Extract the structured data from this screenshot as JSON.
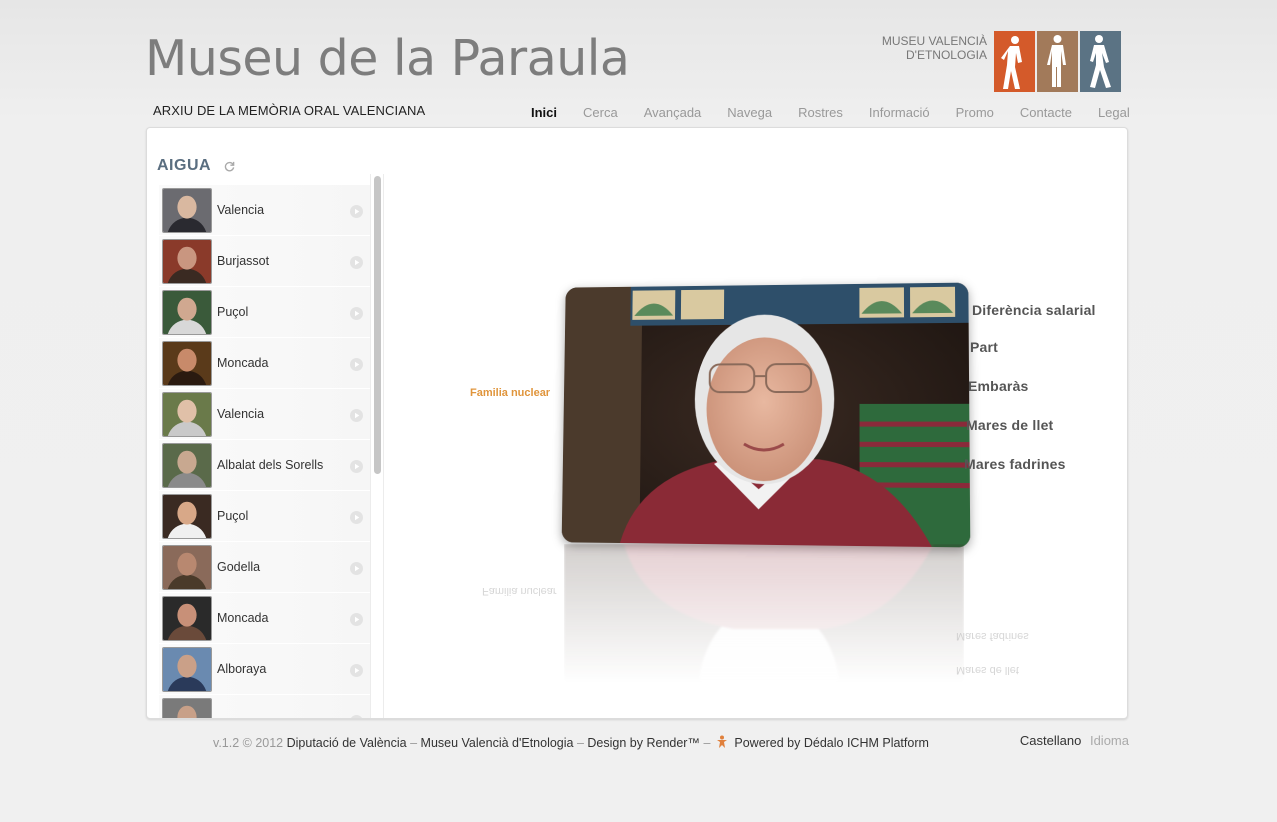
{
  "site": {
    "title": "Museu de la Paraula",
    "subtitle": "ARXIU DE LA MEMÒRIA ORAL VALENCIANA",
    "logo_line1": "MUSEU VALENCIÀ",
    "logo_line2": "D'ETNOLOGIA",
    "logo_colors": [
      "#d45a2a",
      "#a27a5a",
      "#5b7384"
    ]
  },
  "nav": {
    "items": [
      {
        "label": "Inici",
        "active": true
      },
      {
        "label": "Cerca"
      },
      {
        "label": "Avançada"
      },
      {
        "label": "Navega"
      },
      {
        "label": "Rostres"
      },
      {
        "label": "Informació"
      },
      {
        "label": "Promo"
      },
      {
        "label": "Contacte"
      },
      {
        "label": "Legal"
      }
    ]
  },
  "sidebar": {
    "topic": "AIGUA",
    "refresh_icon": "refresh-icon",
    "items": [
      {
        "label": "Valencia"
      },
      {
        "label": "Burjassot"
      },
      {
        "label": "Puçol"
      },
      {
        "label": "Moncada"
      },
      {
        "label": "Valencia"
      },
      {
        "label": "Albalat dels Sorells"
      },
      {
        "label": "Puçol"
      },
      {
        "label": "Godella"
      },
      {
        "label": "Moncada"
      },
      {
        "label": "Alboraya"
      },
      {
        "label": ""
      }
    ]
  },
  "stage": {
    "left_tag": "Familia nuclear",
    "right_tags": [
      "Diferència salarial",
      "Part",
      "Embaràs",
      "Mares de llet",
      "Mares fadrines"
    ]
  },
  "footer": {
    "version": "v.1.2 © 2012",
    "link1": "Diputació de València",
    "sep": "–",
    "link2": "Museu Valencià d'Etnologia",
    "link3": "Design by Render™",
    "link4": "Powered by Dédalo ICHM Platform",
    "lang_link": "Castellano",
    "lang_label": "Idioma"
  },
  "colors": {
    "accent_title": "#5a6e80",
    "tag_orange": "#e0953c"
  }
}
